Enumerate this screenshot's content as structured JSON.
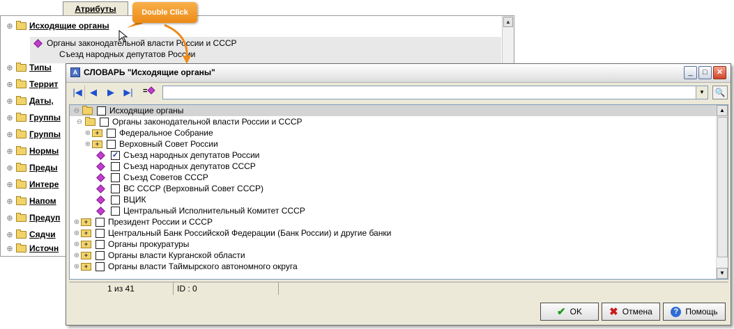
{
  "background": {
    "tab_label": "Атрибуты",
    "root_label": "Исходящие органы",
    "child_lines": [
      "Органы законодательной власти России и СССР",
      "Съезд народных депутатов России"
    ],
    "items": [
      "Типы",
      "Террит",
      "Даты, ",
      "Группы",
      "Группы",
      "Нормы",
      "Преды",
      "Интере",
      "Напом",
      "Предуп",
      "Сядчи",
      "Источн"
    ]
  },
  "callout": {
    "label": "Double Click"
  },
  "dialog": {
    "title": "СЛОВАРЬ \"Исходящие органы\"",
    "toolbar": {
      "nav_first": "|◀",
      "nav_prev": "◀",
      "nav_next": "▶",
      "nav_last": "▶|",
      "filter_symbol": "=",
      "search_value": ""
    },
    "tree": {
      "rows": [
        {
          "label": "Исходящие органы",
          "selected": true
        },
        {
          "label": "Органы законодательной власти России и СССР"
        },
        {
          "label": "Федеральное Собрание"
        },
        {
          "label": "Верховный Совет России"
        },
        {
          "label": "Съезд народных депутатов России",
          "checked": true
        },
        {
          "label": "Съезд народных депутатов СССР"
        },
        {
          "label": "Съезд Советов СССР"
        },
        {
          "label": "ВС СССР (Верховный Совет СССР)"
        },
        {
          "label": "ВЦИК"
        },
        {
          "label": "Центральный Исполнительный Комитет СССР"
        },
        {
          "label": "Президент России и СССР"
        },
        {
          "label": "Центральный Банк Российской Федерации (Банк России) и другие банки"
        },
        {
          "label": "Органы прокуратуры"
        },
        {
          "label": "Органы власти Курганской области"
        },
        {
          "label": "Органы власти Таймырского автономного округа"
        }
      ]
    },
    "status": {
      "count": "1 из 41",
      "id": "ID : 0"
    },
    "buttons": {
      "ok": "OK",
      "cancel": "Отмена",
      "help": "Помощь"
    }
  },
  "colors": {
    "accent_callout": "#ed8b17",
    "diamond": "#c33bd1",
    "nav_blue": "#1d4fcf"
  },
  "icons": [
    "folder-icon",
    "diamond-icon",
    "checkbox-icon",
    "search-icon",
    "ok-check-icon",
    "cancel-x-icon",
    "help-icon"
  ]
}
